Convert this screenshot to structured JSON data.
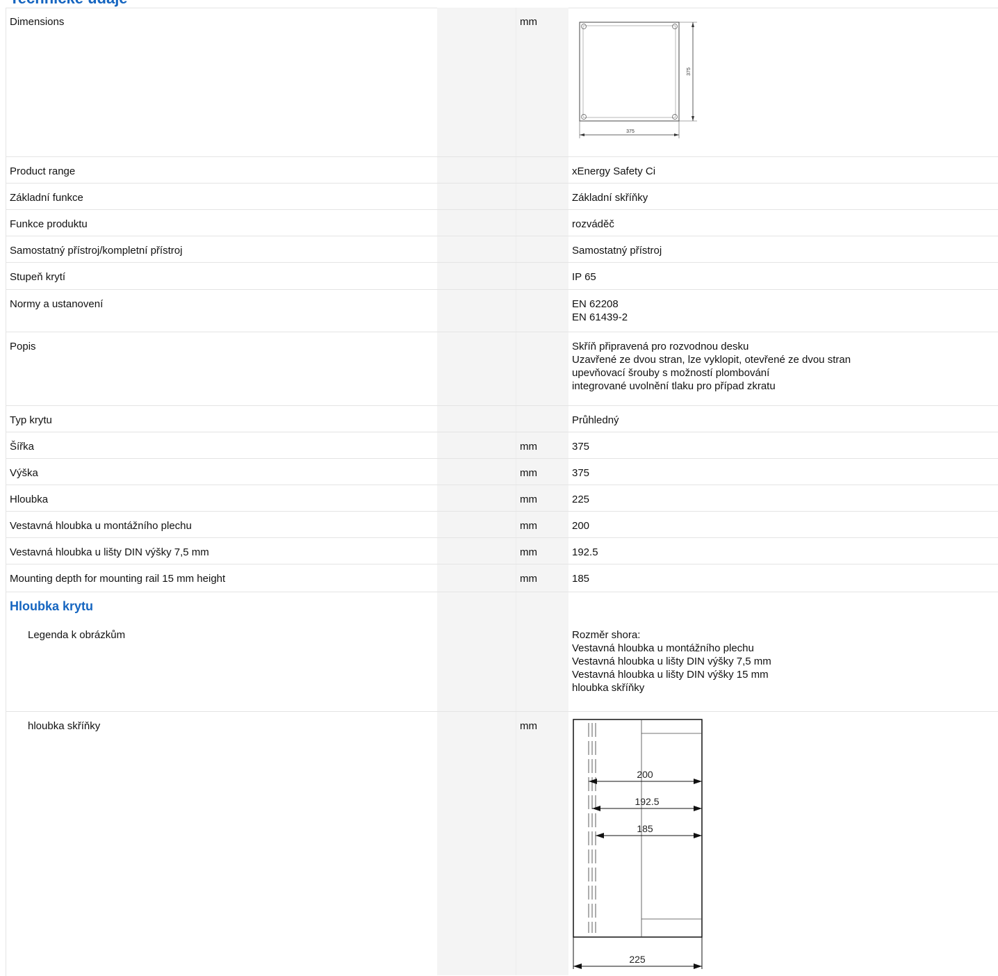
{
  "header": {
    "cut_title": "Technické údaje"
  },
  "rows": {
    "dimensions": {
      "label": "Dimensions",
      "unit": "mm",
      "dim_width": "375",
      "dim_height": "375"
    },
    "product_range": {
      "label": "Product range",
      "value": "xEnergy Safety Ci"
    },
    "basic_function": {
      "label": "Základní funkce",
      "value": "Základní skříňky"
    },
    "product_function": {
      "label": "Funkce produktu",
      "value": "rozváděč"
    },
    "device_type": {
      "label": "Samostatný přístroj/kompletní přístroj",
      "value": "Samostatný přístroj"
    },
    "protection": {
      "label": "Stupeň krytí",
      "value": "IP 65"
    },
    "standards": {
      "label": "Normy a ustanovení",
      "values": [
        "EN 62208",
        "EN 61439-2"
      ]
    },
    "description": {
      "label": "Popis",
      "values": [
        "Skříň připravená pro rozvodnou desku",
        "Uzavřené ze dvou stran, lze vyklopit, otevřené ze dvou stran",
        "upevňovací šrouby s možností plombování",
        "integrované uvolnění tlaku pro případ zkratu"
      ]
    },
    "cover_type": {
      "label": "Typ krytu",
      "value": "Průhledný"
    },
    "width": {
      "label": "Šířka",
      "unit": "mm",
      "value": "375"
    },
    "height": {
      "label": "Výška",
      "unit": "mm",
      "value": "375"
    },
    "depth": {
      "label": "Hloubka",
      "unit": "mm",
      "value": "225"
    },
    "depth_plate": {
      "label": "Vestavná hloubka u montážního plechu",
      "unit": "mm",
      "value": "200"
    },
    "depth_din75": {
      "label": "Vestavná hloubka u lišty DIN výšky 7,5 mm",
      "unit": "mm",
      "value": "192.5"
    },
    "depth_din15": {
      "label": "Mounting depth for mounting rail 15 mm height",
      "unit": "mm",
      "value": "185"
    }
  },
  "section": {
    "title": "Hloubka krytu",
    "legend": {
      "label": "Legenda k obrázkům",
      "values": [
        "Rozměr shora:",
        "Vestavná hloubka u montážního plechu",
        "Vestavná hloubka u lišty DIN výšky 7,5 mm",
        "Vestavná hloubka u lišty DIN výšky 15 mm",
        "hloubka skříňky"
      ]
    },
    "box_depth": {
      "label": "hloubka skříňky",
      "unit": "mm",
      "d1": "200",
      "d2": "192.5",
      "d3": "185",
      "d4": "225"
    }
  }
}
